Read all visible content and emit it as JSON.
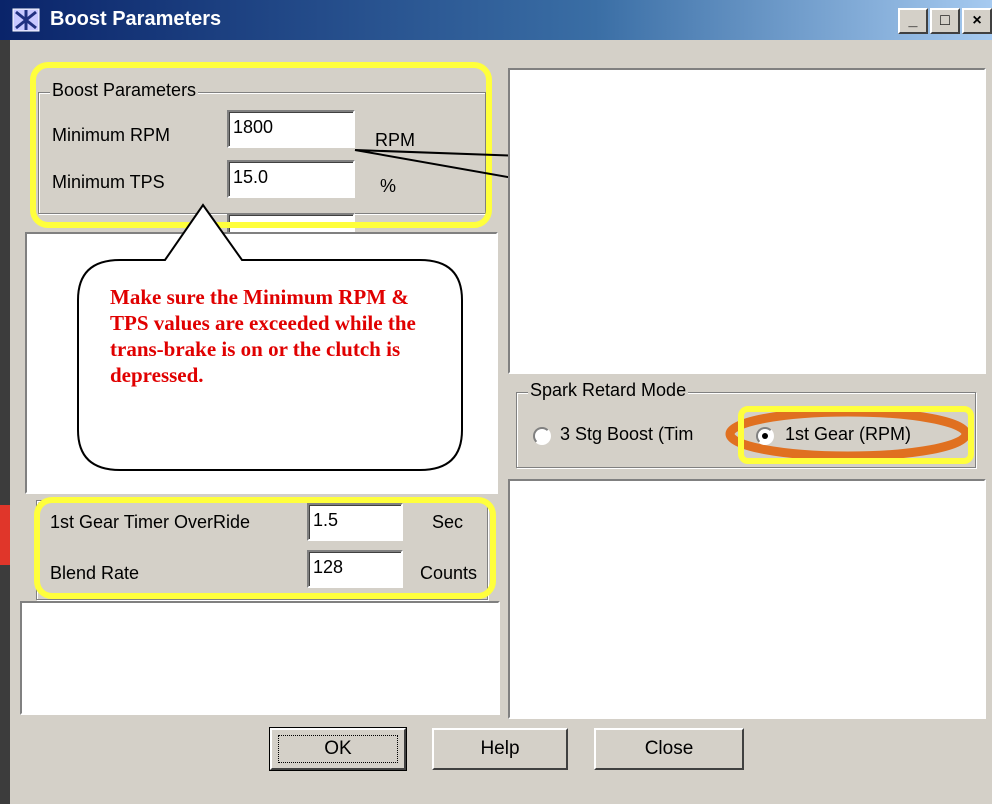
{
  "window": {
    "title": "Boost Parameters",
    "controls": [
      "_",
      "□",
      "×"
    ]
  },
  "boost_group": {
    "legend": "Boost Parameters",
    "min_rpm": {
      "label": "Minimum RPM",
      "value": "1800",
      "unit": "RPM"
    },
    "min_tps": {
      "label": "Minimum TPS",
      "value": "15.0",
      "unit": "%"
    }
  },
  "callout": {
    "text": "Make sure the Minimum RPM & TPS values are exceeded while the trans-brake is on or the clutch is depressed."
  },
  "timer_group": {
    "gear_timer": {
      "label": "1st Gear Timer OverRide",
      "value": "1.5",
      "unit": "Sec"
    },
    "blend_rate": {
      "label": "Blend Rate",
      "value": "128",
      "unit": "Counts"
    }
  },
  "spark_retard": {
    "legend": "Spark Retard Mode",
    "options": [
      {
        "label": "3 Stg Boost (Tim",
        "selected": false
      },
      {
        "label": "1st Gear (RPM)",
        "selected": true
      }
    ]
  },
  "buttons": {
    "ok": "OK",
    "help": "Help",
    "close": "Close"
  },
  "colors": {
    "highlight": "#ffff3c",
    "oval": "#e07020",
    "callout_text": "#e00000"
  }
}
